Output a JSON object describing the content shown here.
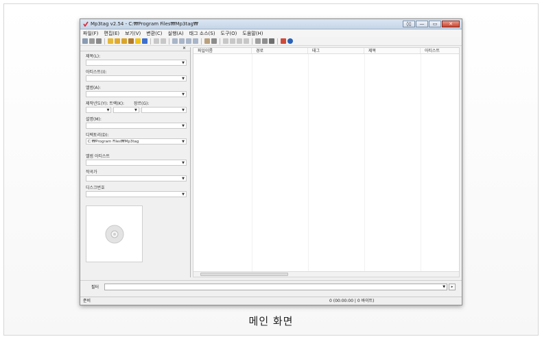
{
  "caption": "메인 화면",
  "window": {
    "title": "Mp3tag v2.54 - C:₩Program Files₩Mp3tag₩",
    "buttons": [
      "◊",
      "▯",
      "—",
      "▭",
      "✕"
    ]
  },
  "menu": [
    "파일(F)",
    "편집(E)",
    "보기(V)",
    "변환(C)",
    "실행(A)",
    "태그 소스(S)",
    "도구(O)",
    "도움말(H)"
  ],
  "left_panel": {
    "fields": [
      {
        "label": "제목(L):",
        "value": ""
      },
      {
        "label": "아티스트(I):",
        "value": ""
      },
      {
        "label": "앨범(A):",
        "value": ""
      },
      {
        "label": "제작년도(Y):",
        "value": ""
      },
      {
        "label": "설명(M):",
        "value": ""
      },
      {
        "label": "디렉토리(D):",
        "value": "C:₩Program Files₩Mp3tag"
      },
      {
        "label": "앨범 아티스트",
        "value": ""
      },
      {
        "label": "작곡가",
        "value": ""
      },
      {
        "label": "디스크번호",
        "value": ""
      }
    ],
    "track_label": "트랙(K):",
    "genre_label": "장르(G):"
  },
  "file_list": {
    "columns": [
      "파일이름",
      "경로",
      "태그",
      "제목",
      "아티스트"
    ]
  },
  "filter": {
    "label": "필터"
  },
  "status": {
    "left": "준비",
    "right": "0 (00:00:00 | 0 바이트)"
  },
  "colors": {
    "accent": "#2a62b8",
    "close": "#c9452f"
  }
}
